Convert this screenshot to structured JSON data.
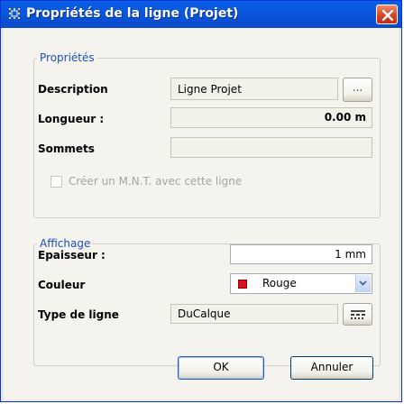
{
  "window": {
    "title": "Propriétés de la ligne (Projet)"
  },
  "proprietes": {
    "legend": "Propriétés",
    "description_label": "Description",
    "description_value": "Ligne Projet",
    "browse_label": "...",
    "longueur_label": "Longueur :",
    "longueur_value": "0.00 m",
    "sommets_label": "Sommets",
    "sommets_value": "",
    "mnt_checkbox_label": "Créer un M.N.T. avec cette ligne",
    "mnt_checked": false
  },
  "affichage": {
    "legend": "Affichage",
    "epaisseur_label": "Epaisseur :",
    "epaisseur_value": "1 mm",
    "couleur_label": "Couleur",
    "couleur_value": "Rouge",
    "couleur_swatch": "#d8141c",
    "typeligne_label": "Type de ligne",
    "typeligne_value": "DuCalque"
  },
  "buttons": {
    "ok": "OK",
    "cancel": "Annuler"
  },
  "colors": {
    "titlebar": "#0a56dc",
    "legend": "#1f4fb5",
    "client": "#f4f3ee"
  },
  "icons": {
    "title": "grid-icon",
    "close": "close-icon",
    "dropdown": "chevron-down-icon",
    "linetype": "line-style-icon"
  }
}
